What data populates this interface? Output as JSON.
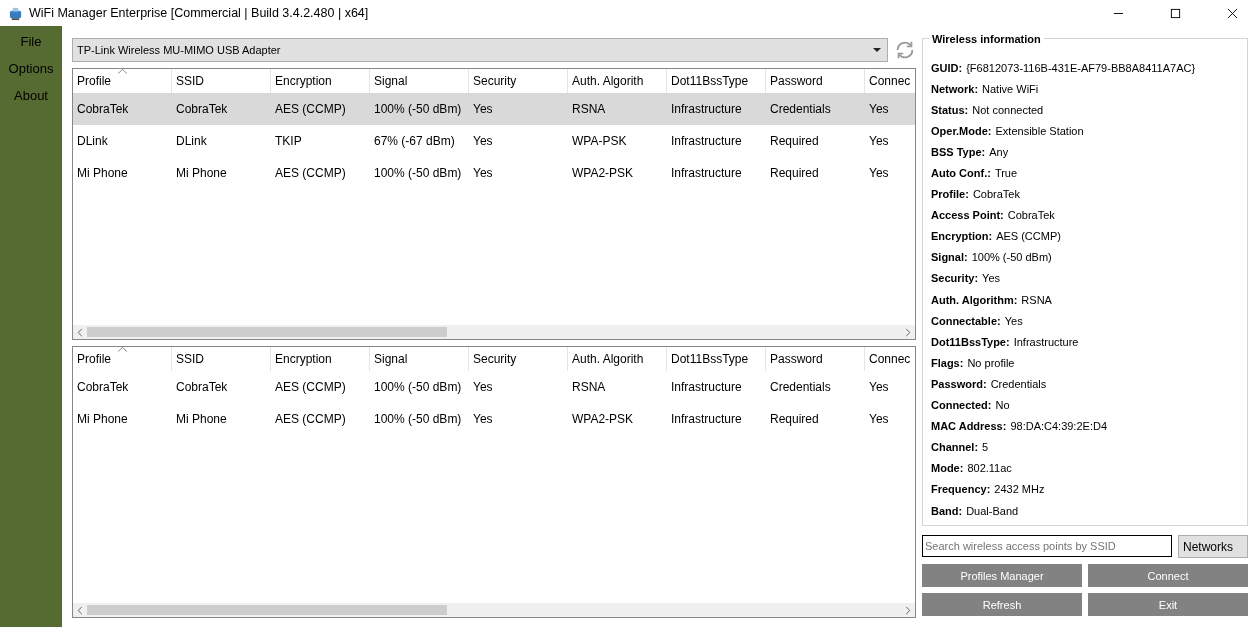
{
  "window": {
    "title": "WiFi Manager Enterprise [Commercial | Build 3.4.2.480 | x64]"
  },
  "sidebar": {
    "items": [
      {
        "label": "File"
      },
      {
        "label": "Options"
      },
      {
        "label": "About"
      }
    ]
  },
  "adapter": {
    "value": "TP-Link Wireless MU-MIMO USB Adapter"
  },
  "profiles_table": {
    "columns": [
      "Profile",
      "SSID",
      "Encryption",
      "Signal",
      "Security",
      "Auth. Algorith",
      "Dot11BssType",
      "Password",
      "Connec"
    ],
    "rows": [
      {
        "selected": true,
        "cells": [
          "CobraTek",
          "CobraTek",
          "AES (CCMP)",
          "100% (-50 dBm)",
          "Yes",
          "RSNA",
          "Infrastructure",
          "Credentials",
          "Yes"
        ]
      },
      {
        "selected": false,
        "cells": [
          "DLink",
          "DLink",
          "TKIP",
          "67% (-67 dBm)",
          "Yes",
          "WPA-PSK",
          "Infrastructure",
          "Required",
          "Yes"
        ]
      },
      {
        "selected": false,
        "cells": [
          "Mi Phone",
          "Mi Phone",
          "AES (CCMP)",
          "100% (-50 dBm)",
          "Yes",
          "WPA2-PSK",
          "Infrastructure",
          "Required",
          "Yes"
        ]
      }
    ]
  },
  "networks_table": {
    "columns": [
      "Profile",
      "SSID",
      "Encryption",
      "Signal",
      "Security",
      "Auth. Algorith",
      "Dot11BssType",
      "Password",
      "Connec"
    ],
    "rows": [
      {
        "selected": false,
        "cells": [
          "CobraTek",
          "CobraTek",
          "AES (CCMP)",
          "100% (-50 dBm)",
          "Yes",
          "RSNA",
          "Infrastructure",
          "Credentials",
          "Yes"
        ]
      },
      {
        "selected": false,
        "cells": [
          "Mi Phone",
          "Mi Phone",
          "AES (CCMP)",
          "100% (-50 dBm)",
          "Yes",
          "WPA2-PSK",
          "Infrastructure",
          "Required",
          "Yes"
        ]
      }
    ]
  },
  "info": {
    "title": "Wireless information",
    "items": [
      {
        "label": "GUID:",
        "value": "{F6812073-116B-431E-AF79-BB8A8411A7AC}"
      },
      {
        "label": "Network:",
        "value": "Native WiFi"
      },
      {
        "label": "Status:",
        "value": "Not connected"
      },
      {
        "label": "Oper.Mode:",
        "value": "Extensible Station"
      },
      {
        "label": "BSS Type:",
        "value": "Any"
      },
      {
        "label": "Auto Conf.:",
        "value": "True"
      },
      {
        "label": "Profile:",
        "value": "CobraTek"
      },
      {
        "label": "Access Point:",
        "value": "CobraTek"
      },
      {
        "label": "Encryption:",
        "value": "AES (CCMP)"
      },
      {
        "label": "Signal:",
        "value": "100% (-50 dBm)"
      },
      {
        "label": "Security:",
        "value": "Yes"
      },
      {
        "label": "Auth. Algorithm:",
        "value": "RSNA"
      },
      {
        "label": "Connectable:",
        "value": "Yes"
      },
      {
        "label": "Dot11BssType:",
        "value": "Infrastructure"
      },
      {
        "label": "Flags:",
        "value": "No profile"
      },
      {
        "label": "Password:",
        "value": "Credentials"
      },
      {
        "label": "Connected:",
        "value": "No"
      },
      {
        "label": "MAC Address:",
        "value": "98:DA:C4:39:2E:D4"
      },
      {
        "label": "Channel:",
        "value": "5"
      },
      {
        "label": "Mode:",
        "value": "802.11ac"
      },
      {
        "label": "Frequency:",
        "value": "2432 MHz"
      },
      {
        "label": "Band:",
        "value": "Dual-Band"
      }
    ]
  },
  "search": {
    "placeholder": "Search wireless access points by SSID"
  },
  "filter": {
    "value": "Networks"
  },
  "buttons": [
    "Profiles Manager",
    "Connect",
    "Refresh",
    "Exit"
  ]
}
